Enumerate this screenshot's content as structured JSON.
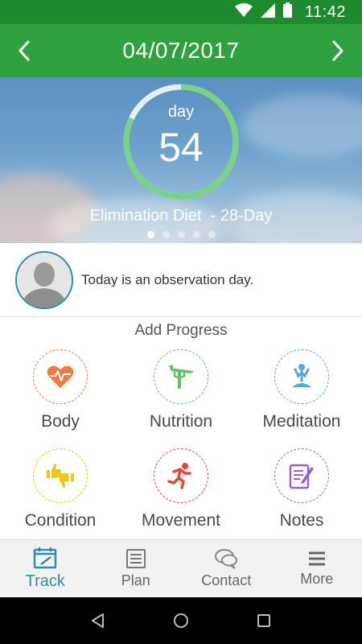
{
  "status_bar": {
    "time": "11:42",
    "icons": [
      "wifi-icon",
      "signal-icon",
      "battery-icon"
    ],
    "color": "#1e8a2e"
  },
  "header": {
    "date": "04/07/2017",
    "prev_icon": "chevron-left-icon",
    "next_icon": "chevron-right-icon",
    "color": "#30a13f"
  },
  "hero": {
    "day_label": "day",
    "day_number": "54",
    "program": "Elimination Diet  - 28-Day",
    "day_progress": 0.82,
    "pages": 5,
    "active_page": 0,
    "ring_color": "#79d37f"
  },
  "message": {
    "text": "Today is an observation day."
  },
  "progress": {
    "title": "Add Progress",
    "items": [
      {
        "label": "Body",
        "icon": "heart-rate-icon",
        "color": "#ef7a3e"
      },
      {
        "label": "Nutrition",
        "icon": "fork-carrot-icon",
        "color": "#5cc463"
      },
      {
        "label": "Meditation",
        "icon": "meditation-icon",
        "color": "#55a9d8"
      },
      {
        "label": "Condition",
        "icon": "thumbs-up-down-icon",
        "color": "#f0c419"
      },
      {
        "label": "Movement",
        "icon": "running-icon",
        "color": "#e8453c"
      },
      {
        "label": "Notes",
        "icon": "notes-icon",
        "color": "#9a62c8"
      }
    ]
  },
  "bottom_nav": {
    "items": [
      {
        "label": "Track",
        "icon": "calendar-icon",
        "active": true
      },
      {
        "label": "Plan",
        "icon": "list-icon",
        "active": false
      },
      {
        "label": "Contact",
        "icon": "chat-icon",
        "active": false
      },
      {
        "label": "More",
        "icon": "menu-icon",
        "active": false
      }
    ],
    "active_color": "#2f8fa8"
  },
  "system_nav": {
    "icons": [
      "back-icon",
      "home-icon",
      "recents-icon"
    ]
  }
}
